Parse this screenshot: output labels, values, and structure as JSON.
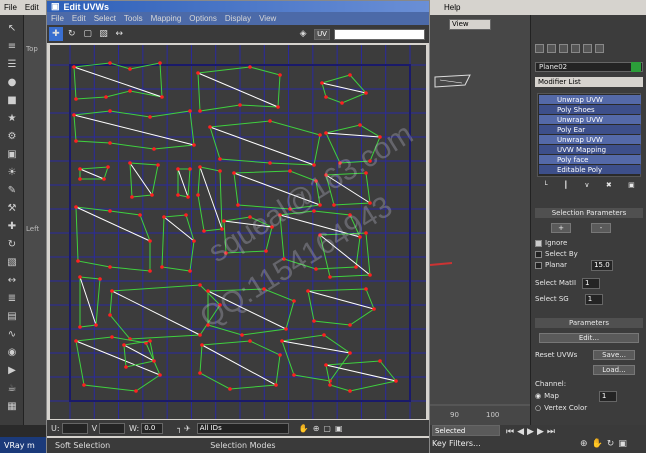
{
  "app_menu": {
    "items": [
      "File",
      "Edit",
      "To"
    ]
  },
  "right_menu": {
    "items": [
      "Help"
    ]
  },
  "uvw": {
    "title": "Edit UVWs",
    "menu": [
      "File",
      "Edit",
      "Select",
      "Tools",
      "Mapping",
      "Options",
      "Display",
      "View"
    ],
    "uv_label": "UV",
    "bottom": {
      "u_label": "U:",
      "v_label": "V",
      "w_label": "W:",
      "w_value": "0.0",
      "dropdown": "All IDs"
    },
    "status_left": "Soft Selection",
    "status_right": "Selection Modes"
  },
  "right_panel": {
    "view_dropdown": "View",
    "object_name": "Plane02",
    "modifier_list": "Modifier List",
    "stack": [
      "Unwrap UVW",
      "Poly Shoes",
      "Unwrap UVW",
      "Poly Ear",
      "Unwrap UVW",
      "UVW Mapping",
      "Poly face",
      "Editable Poly"
    ],
    "selection_params_title": "Selection Parameters",
    "plus": "+",
    "minus": "-",
    "ignore": "Ignore",
    "select_by": "Select By",
    "planar": "Planar",
    "planar_value": "15.0",
    "select_matid": "Select MatII",
    "select_matid_value": "1",
    "select_sg": "Select SG",
    "select_sg_value": "1",
    "parameters_title": "Parameters",
    "edit_btn": "Edit...",
    "reset_uvws": "Reset UVWs",
    "save_btn": "Save...",
    "load_btn": "Load...",
    "channel_label": "Channel:",
    "map_label": "Map",
    "map_value": "1",
    "vertex_color": "Vertex Color"
  },
  "timeline": {
    "tick_90": "90",
    "tick_100": "100"
  },
  "bottom_right": {
    "selected": "Selected",
    "key_filters": "Key Filters..."
  },
  "vray": {
    "label": "VRay m"
  },
  "viewport_left_labels": [
    "Top",
    "Left"
  ],
  "watermark": {
    "line1": "squeal@163.com",
    "line2": "QQ:1154164943"
  }
}
